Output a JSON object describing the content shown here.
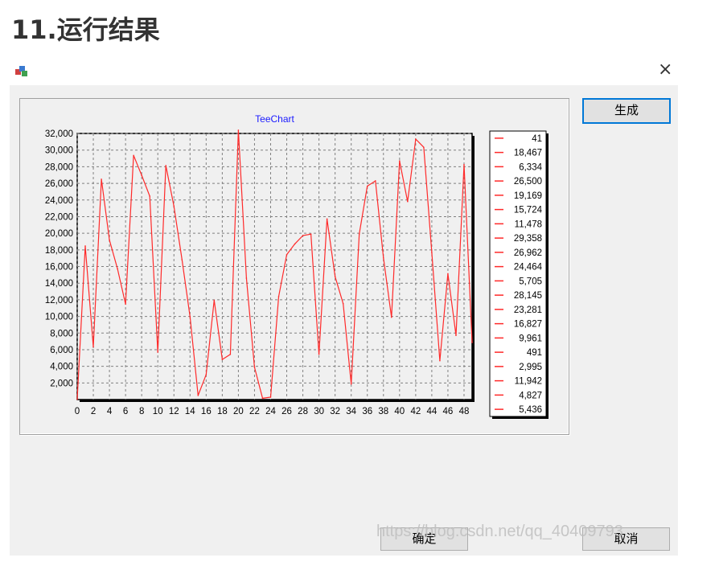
{
  "page": {
    "heading": "11.运行结果"
  },
  "window": {
    "close_glyph": "×",
    "icon": "app-icon"
  },
  "buttons": {
    "generate": "生成",
    "ok": "确定",
    "cancel": "取消"
  },
  "watermark": "https://blog.csdn.net/qq_40409793",
  "colors": {
    "series": "#ff2a2a",
    "title": "#1a1aff",
    "panel": "#f0f0f0",
    "accent": "#0078d7"
  },
  "chart_data": {
    "type": "line",
    "title": "TeeChart",
    "xlabel": "",
    "ylabel": "",
    "grid": true,
    "legend_position": "right",
    "xlim": [
      0,
      49
    ],
    "ylim": [
      0,
      32000
    ],
    "x_ticks": [
      0,
      2,
      4,
      6,
      8,
      10,
      12,
      14,
      16,
      18,
      20,
      22,
      24,
      26,
      28,
      30,
      32,
      34,
      36,
      38,
      40,
      42,
      44,
      46,
      48
    ],
    "y_ticks": [
      2000,
      4000,
      6000,
      8000,
      10000,
      12000,
      14000,
      16000,
      18000,
      20000,
      22000,
      24000,
      26000,
      28000,
      30000,
      32000
    ],
    "legend_labels": [
      "41",
      "18,467",
      "6,334",
      "26,500",
      "19,169",
      "15,724",
      "11,478",
      "29,358",
      "26,962",
      "24,464",
      "5,705",
      "28,145",
      "23,281",
      "16,827",
      "9,961",
      "491",
      "2,995",
      "11,942",
      "4,827",
      "5,436"
    ],
    "series": [
      {
        "values": [
          41,
          18467,
          6334,
          26500,
          19169,
          15724,
          11478,
          29358,
          26962,
          24464,
          5705,
          28145,
          23281,
          16827,
          9961,
          491,
          2995,
          11942,
          4827,
          5436,
          32391,
          14604,
          3902,
          153,
          292,
          12382,
          17421,
          18716,
          19718,
          19895,
          5447,
          21726,
          14771,
          11538,
          1869,
          19912,
          25667,
          26299,
          17035,
          9894,
          28703,
          23811,
          31322,
          30333,
          17673,
          4664,
          15141,
          7711,
          28253,
          6868
        ]
      }
    ]
  }
}
